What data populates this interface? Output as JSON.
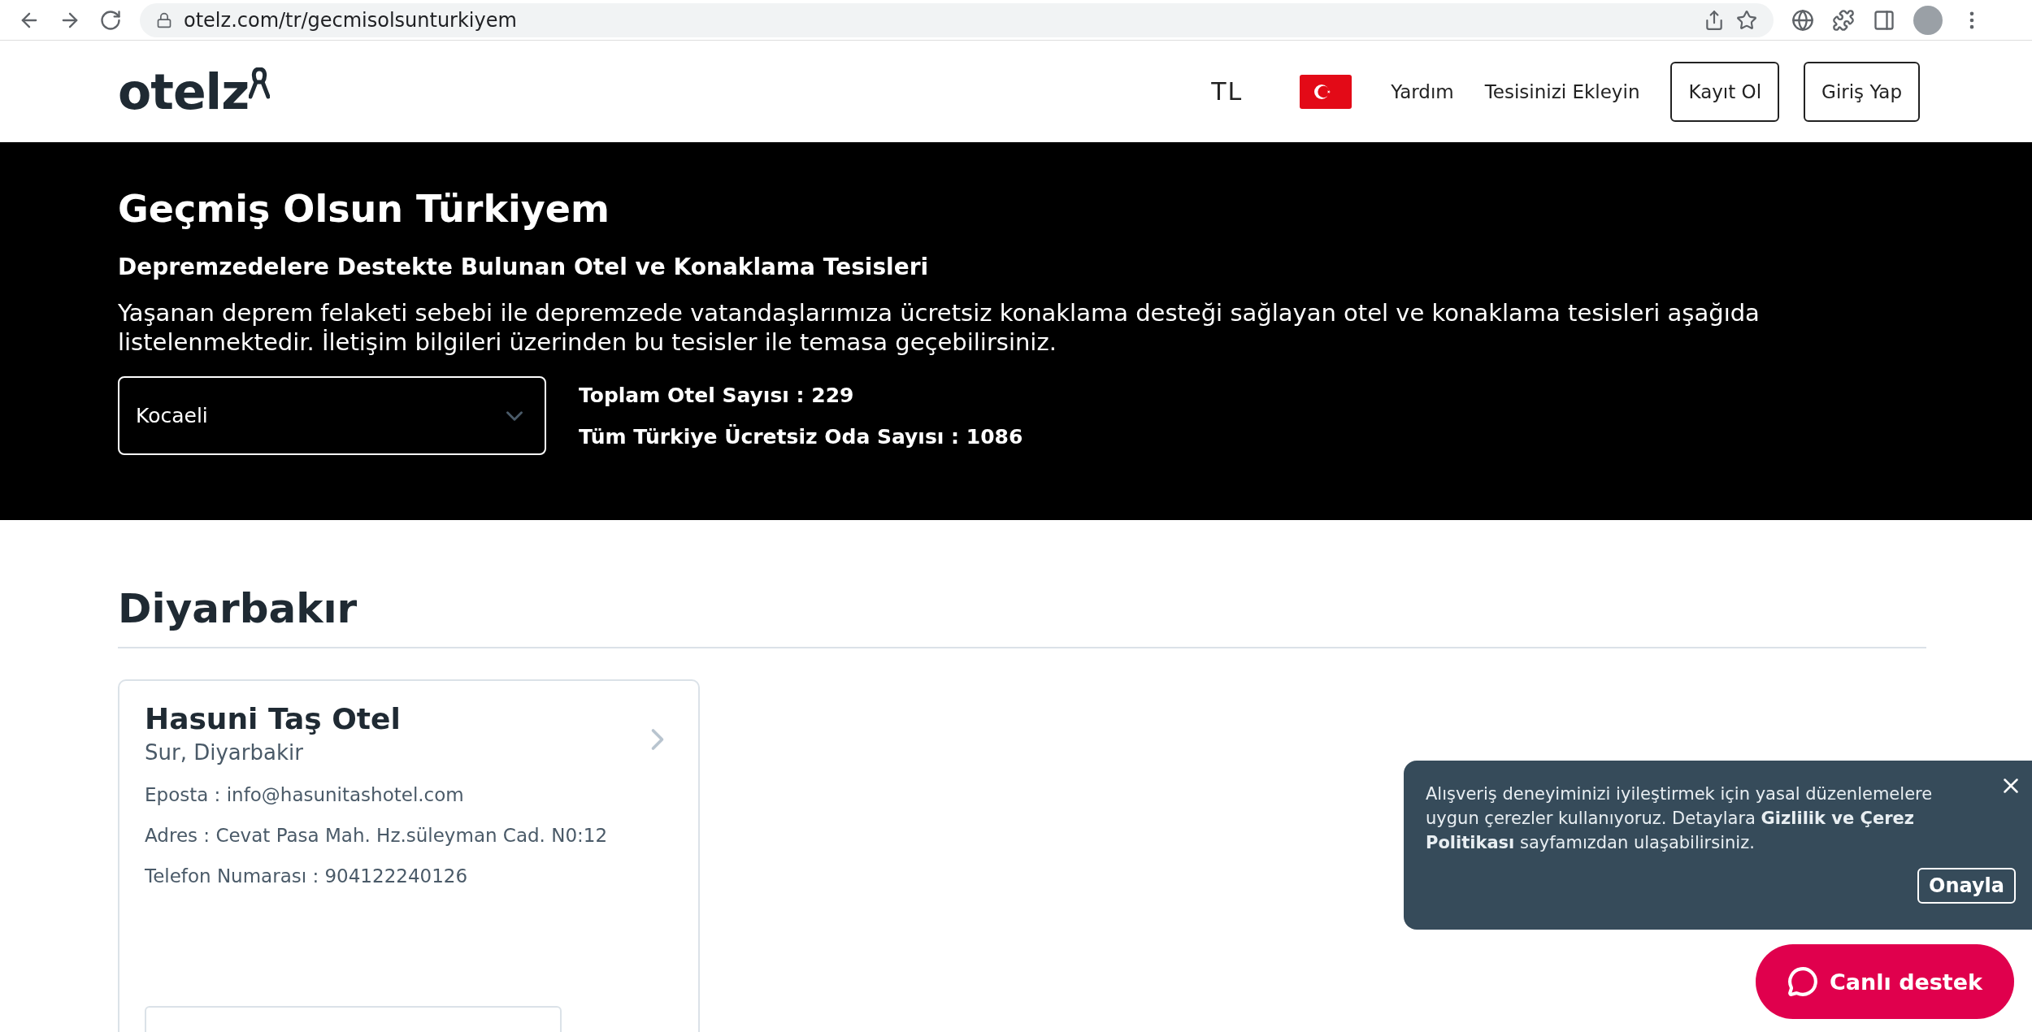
{
  "browser": {
    "url": "otelz.com/tr/gecmisolsunturkiyem"
  },
  "header": {
    "logo": "otelz",
    "currency": "TL",
    "links": [
      "Yardım",
      "Tesisinizi Ekleyin"
    ],
    "buttons": [
      "Kayıt Ol",
      "Giriş Yap"
    ]
  },
  "hero": {
    "title": "Geçmiş Olsun Türkiyem",
    "subtitle": "Depremzedelere Destekte Bulunan Otel ve Konaklama Tesisleri",
    "description": "Yaşanan deprem felaketi sebebi ile depremzede vatandaşlarımıza ücretsiz konaklama desteği sağlayan otel ve konaklama tesisleri aşağıda listelenmektedir. İletişim bilgileri üzerinden bu tesisler ile temasa geçebilirsiniz.",
    "city_select": {
      "value": "Kocaeli"
    },
    "stats": [
      "Toplam Otel Sayısı : 229",
      "Tüm Türkiye Ücretsiz Oda Sayısı : 1086"
    ]
  },
  "section": {
    "title": "Diyarbakır",
    "hotels": [
      {
        "name": "Hasuni Taş Otel",
        "location": "Sur, Diyarbakir",
        "details": [
          "Eposta : info@hasunitashotel.com",
          "Adres : Cevat Pasa Mah. Hz.süleyman Cad. N0:12",
          "Telefon Numarası : 904122240126"
        ]
      }
    ]
  },
  "cookie_banner": {
    "text": "Alışveriş deneyiminizi iyileştirmek için yasal düzenlemelere uygun çerezler kullanıyoruz. Detaylara **Gizlilik ve Çerez Politikası** sayfamızdan ulaşabilirsiniz.",
    "button": "Onayla"
  },
  "chat_button": {
    "label": "Canlı destek"
  }
}
